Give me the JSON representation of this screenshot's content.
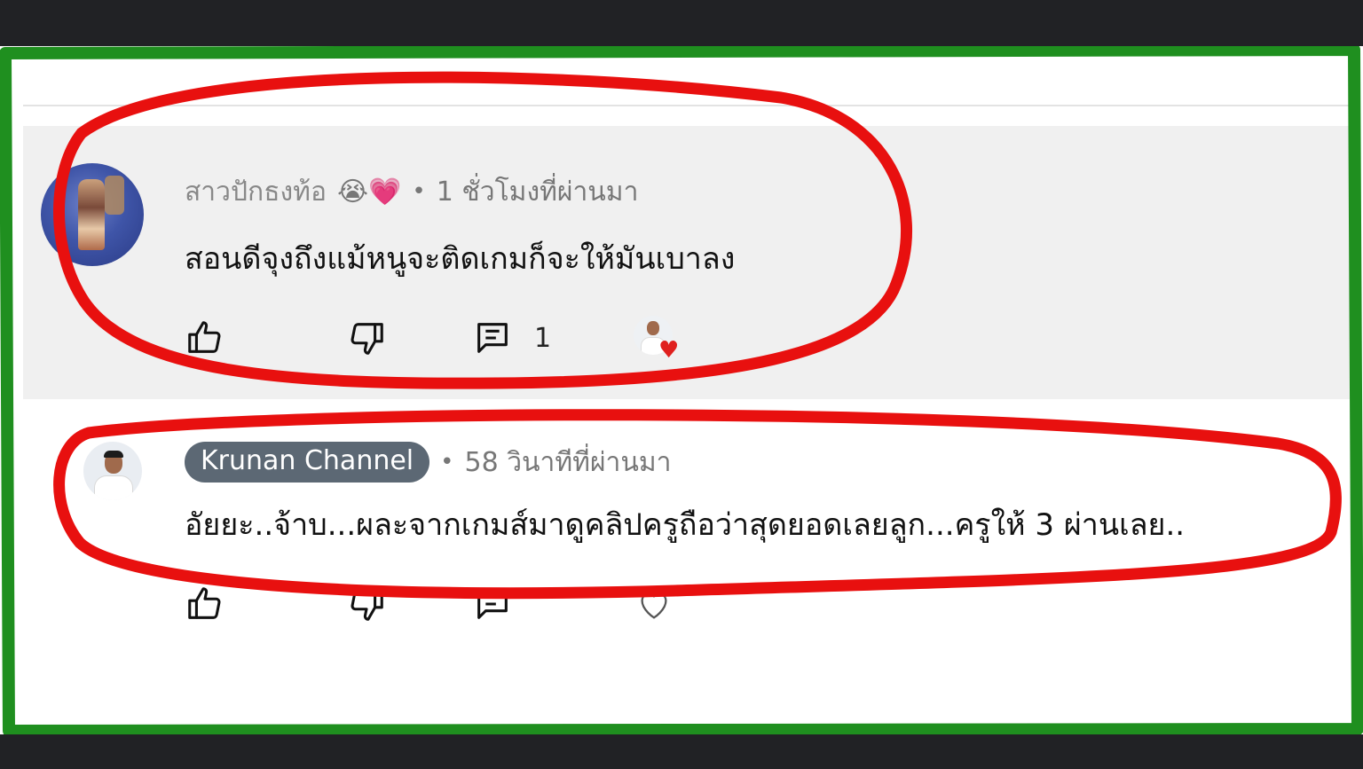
{
  "comments": [
    {
      "author": "สาวปักธงท้อ",
      "author_emojis": "😭💗",
      "separator": "•",
      "time": "1 ชั่วโมงที่ผ่านมา",
      "text": "สอนดีจุงถึงแม้หนูจะติดเกมก็จะให้มันเบาลง",
      "reply_count": "1",
      "creator_hearted": true
    },
    {
      "author": "Krunan Channel",
      "separator": "•",
      "time": "58 วินาทีที่ผ่านมา",
      "text": "อัยยะ..จ้าบ...ผละจากเกมส์มาดูคลิปครูถือว่าสุดยอดเลยลูก...ครูให้ 3 ผ่านเลย..",
      "creator_hearted": false
    }
  ],
  "colors": {
    "annotation_red": "#e8100f",
    "frame_green": "#1f8f1f",
    "badge_bg": "#5c6874",
    "background_dark": "#212225"
  },
  "icons": [
    "thumb-up-icon",
    "thumb-down-icon",
    "reply-icon",
    "heart-icon"
  ]
}
